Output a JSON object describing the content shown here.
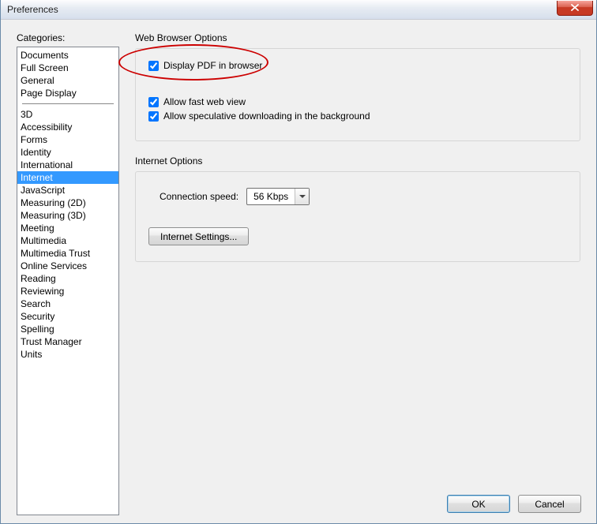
{
  "window": {
    "title": "Preferences"
  },
  "sidebar": {
    "label": "Categories:",
    "group1": [
      {
        "label": "Documents"
      },
      {
        "label": "Full Screen"
      },
      {
        "label": "General"
      },
      {
        "label": "Page Display"
      }
    ],
    "group2": [
      {
        "label": "3D"
      },
      {
        "label": "Accessibility"
      },
      {
        "label": "Forms"
      },
      {
        "label": "Identity"
      },
      {
        "label": "International"
      },
      {
        "label": "Internet",
        "selected": true
      },
      {
        "label": "JavaScript"
      },
      {
        "label": "Measuring (2D)"
      },
      {
        "label": "Measuring (3D)"
      },
      {
        "label": "Meeting"
      },
      {
        "label": "Multimedia"
      },
      {
        "label": "Multimedia Trust"
      },
      {
        "label": "Online Services"
      },
      {
        "label": "Reading"
      },
      {
        "label": "Reviewing"
      },
      {
        "label": "Search"
      },
      {
        "label": "Security"
      },
      {
        "label": "Spelling"
      },
      {
        "label": "Trust Manager"
      },
      {
        "label": "Units"
      }
    ]
  },
  "panel": {
    "webBrowser": {
      "title": "Web Browser Options",
      "displayPdf": "Display PDF in browser",
      "fastWebView": "Allow fast web view",
      "speculative": "Allow speculative downloading in the background"
    },
    "internet": {
      "title": "Internet Options",
      "connSpeedLabel": "Connection speed:",
      "connSpeedValue": "56 Kbps",
      "settingsBtn": "Internet Settings..."
    }
  },
  "buttons": {
    "ok": "OK",
    "cancel": "Cancel"
  }
}
